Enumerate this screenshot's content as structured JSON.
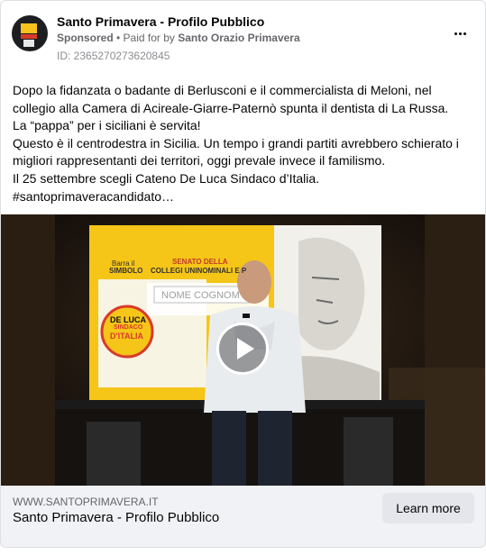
{
  "header": {
    "page_name": "Santo Primavera - Profilo Pubblico",
    "sponsored": "Sponsored",
    "paid_for_prefix": " • Paid for by ",
    "payer": "Santo Orazio Primavera",
    "ad_id": "ID: 2365270273620845",
    "more_icon": "more-horizontal-icon"
  },
  "body": {
    "lines": [
      "Dopo la fidanzata o badante di Berlusconi e il commercialista di Meloni, nel",
      "collegio alla Camera di Acireale-Giarre-Paternò spunta il dentista di La Russa.",
      "La “pappa” per i siciliani è servita!",
      "Questo è il centrodestra in Sicilia. Un tempo i grandi partiti avrebbero schierato i",
      "migliori rappresentanti dei territori, oggi prevale invece il familismo.",
      "Il 25 settembre scegli Cateno De Luca Sindaco d’Italia.",
      "#santoprimaveracandidato…"
    ]
  },
  "video": {
    "play_icon": "play-icon",
    "screen_text": {
      "barra": "Barra il",
      "simbolo": "SIMBOLO",
      "senato": "SENATO DELLA",
      "collegi": "COLLEGI UNINOMINALI E P",
      "nome": "NOME COGNOM",
      "logo_line1": "DE LUCA",
      "logo_line2": "SINDACO",
      "logo_line3": "D'ITALIA"
    }
  },
  "footer": {
    "domain": "WWW.SANTOPRIMAVERA.IT",
    "title": "Santo Primavera - Profilo Pubblico",
    "cta_label": "Learn more"
  },
  "colors": {
    "secondary_text": "#65676b",
    "footer_bg": "#f0f2f5",
    "button_bg": "#e4e6eb",
    "screen_yellow": "#f5c518"
  }
}
